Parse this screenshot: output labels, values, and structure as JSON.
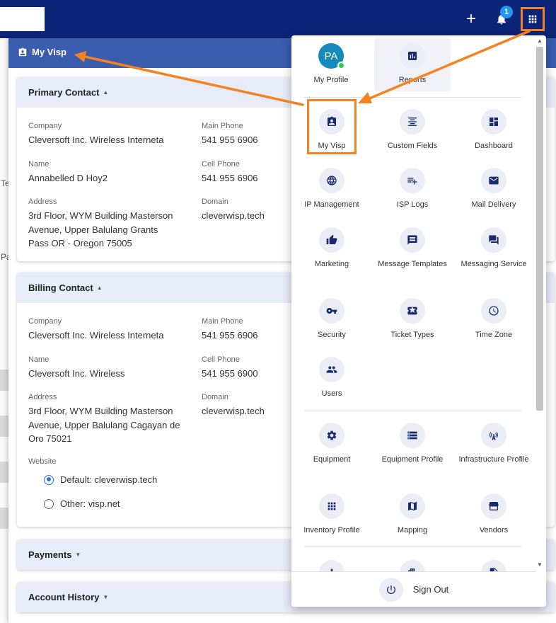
{
  "topbar": {
    "notification_count": "1"
  },
  "left_strip": {
    "t_text": "Te",
    "p_text": "Pa"
  },
  "panel": {
    "title": "My Visp"
  },
  "primary_contact": {
    "title": "Primary Contact",
    "company_label": "Company",
    "company": "Cleversoft Inc. Wireless Interneta",
    "main_phone_label": "Main Phone",
    "main_phone": "541 955 6906",
    "name_label": "Name",
    "name": "Annabelled D Hoy2",
    "cell_phone_label": "Cell Phone",
    "cell_phone": "541 955 6906",
    "address_label": "Address",
    "address_lines": [
      "3rd Floor, WYM Building Masterson",
      "Avenue, Upper Balulang Grants",
      "Pass OR - Oregon 75005"
    ],
    "domain_label": "Domain",
    "domain": "cleverwisp.tech"
  },
  "billing_contact": {
    "title": "Billing Contact",
    "company_label": "Company",
    "company": "Cleversoft Inc. Wireless Interneta",
    "main_phone_label": "Main Phone",
    "main_phone": "541 955 6906",
    "name_label": "Name",
    "name": "Cleversoft Inc. Wireless",
    "cell_phone_label": "Cell Phone",
    "cell_phone": "541 955 6900",
    "address_label": "Address",
    "address_lines": [
      "3rd Floor, WYM Building Masterson",
      "Avenue, Upper Balulang Cagayan de",
      "Oro   75021"
    ],
    "domain_label": "Domain",
    "domain": "cleverwisp.tech",
    "website_label": "Website",
    "website_default": "Default: cleverwisp.tech",
    "website_other": "Other: visp.net",
    "selected_website": "default"
  },
  "payments": {
    "title": "Payments"
  },
  "account_history": {
    "title": "Account History"
  },
  "app_menu": {
    "profile": {
      "initials": "PA",
      "label": "My Profile"
    },
    "reports": {
      "label": "Reports"
    },
    "items": [
      {
        "label": "My Visp",
        "icon": "badge-icon"
      },
      {
        "label": "Custom Fields",
        "icon": "align-center-icon"
      },
      {
        "label": "Dashboard",
        "icon": "dashboard-icon"
      },
      {
        "label": "IP Management",
        "icon": "globe-icon"
      },
      {
        "label": "ISP Logs",
        "icon": "playlist-add-icon"
      },
      {
        "label": "Mail Delivery",
        "icon": "mail-icon"
      },
      {
        "label": "Marketing",
        "icon": "thumb-up-icon"
      },
      {
        "label": "Message Templates",
        "icon": "message-icon"
      },
      {
        "label": "Messaging Service",
        "icon": "forum-icon"
      },
      {
        "label": "Security",
        "icon": "key-icon"
      },
      {
        "label": "Ticket Types",
        "icon": "ticket-icon"
      },
      {
        "label": "Time Zone",
        "icon": "clock-icon"
      },
      {
        "label": "Users",
        "icon": "people-icon"
      }
    ],
    "items2": [
      {
        "label": "Equipment",
        "icon": "settings-icon"
      },
      {
        "label": "Equipment Profile",
        "icon": "storage-icon"
      },
      {
        "label": "Infrastructure Profile",
        "icon": "antenna-icon"
      },
      {
        "label": "Inventory Profile",
        "icon": "grid-icon"
      },
      {
        "label": "Mapping",
        "icon": "map-icon"
      },
      {
        "label": "Vendors",
        "icon": "store-icon"
      }
    ],
    "sign_out": "Sign Out"
  },
  "colors": {
    "topbar": "#0d2579",
    "panel_header": "#3b5db0",
    "accent_orange": "#f58220",
    "card_head": "#e8ecf9",
    "icon": "#1a2b6d"
  }
}
